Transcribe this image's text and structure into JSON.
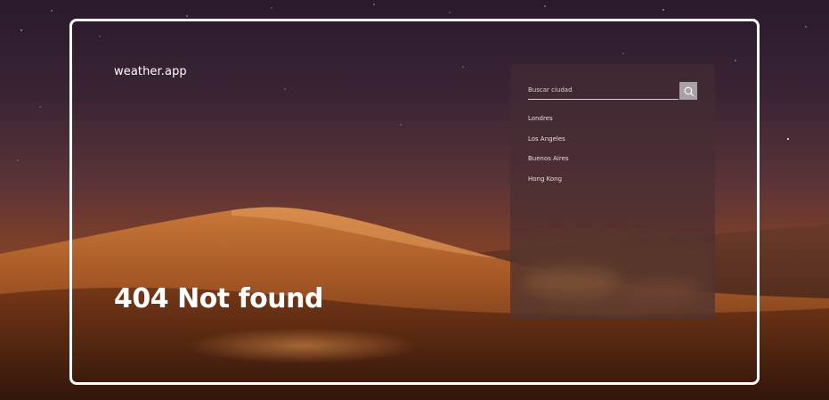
{
  "app": {
    "brand": "weather.app",
    "headline": "404 Not found"
  },
  "search": {
    "placeholder": "Buscar ciudad",
    "value": "",
    "button_icon": "search-icon"
  },
  "cities": [
    "Londres",
    "Los Angeles",
    "Buenos Aires",
    "Hong Kong"
  ],
  "colors": {
    "frame_border": "#ffffff",
    "panel_bg": "#462d32",
    "search_button_bg": "#a7a1a6",
    "text": "#ffffff"
  },
  "background": "desert-dune-night-photo"
}
